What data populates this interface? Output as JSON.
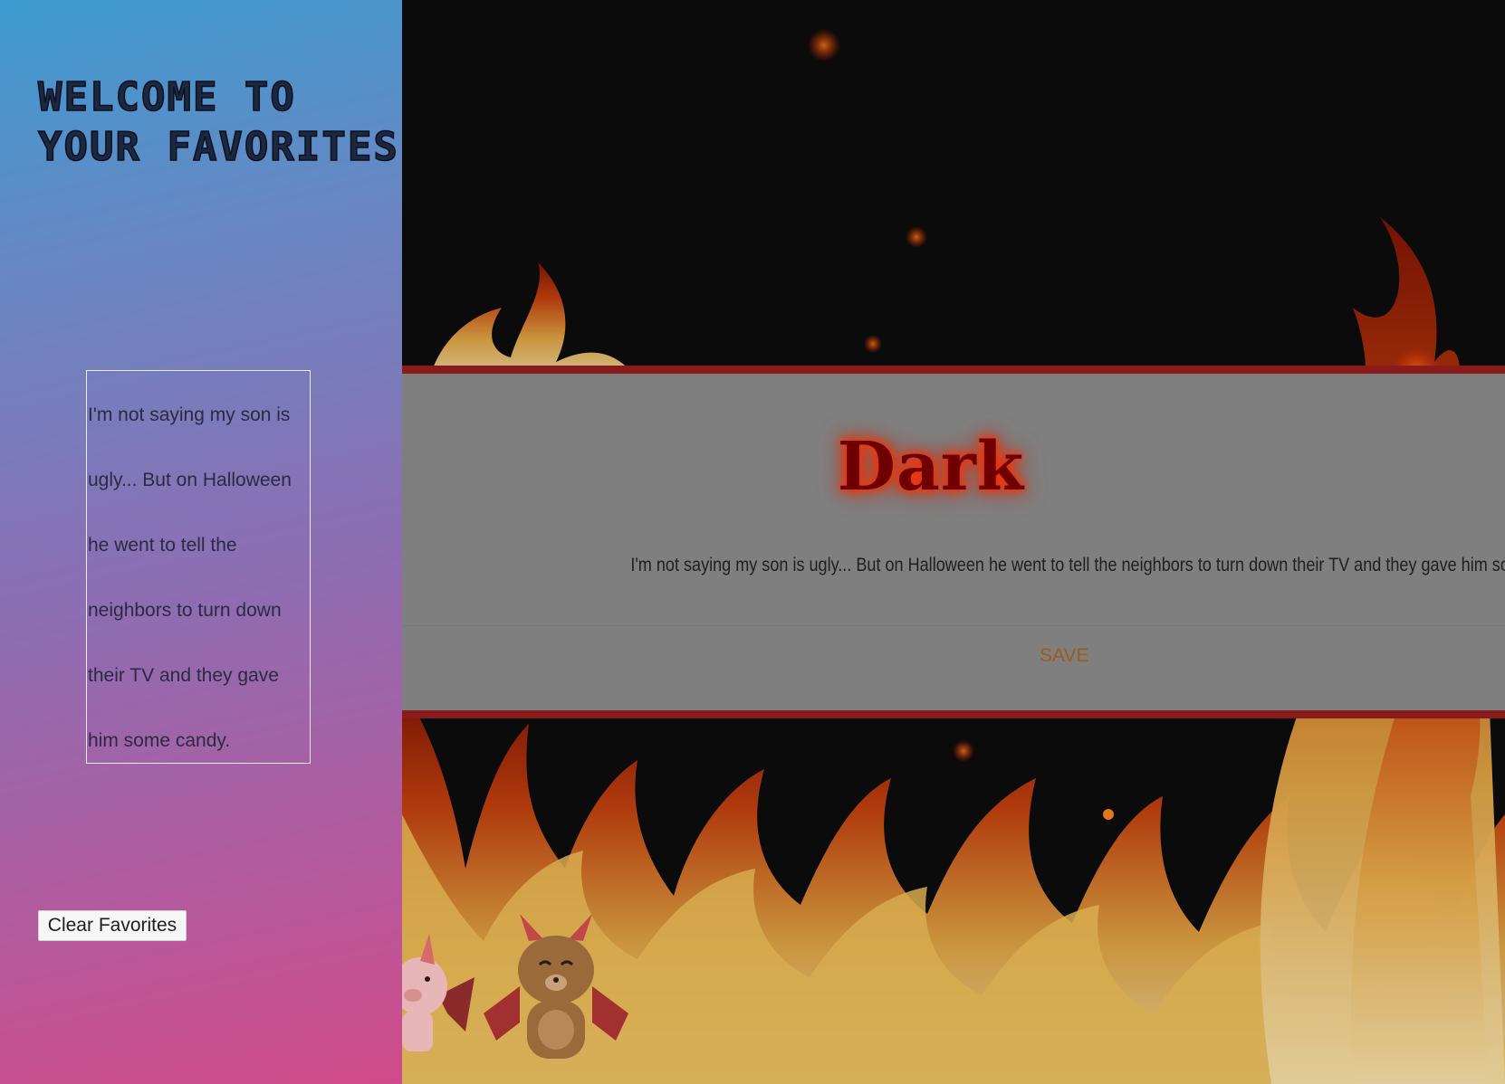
{
  "sidebar": {
    "title": "Welcome to your Favorites",
    "favorites": [
      "I'm not saying my son is ugly... But on Halloween he went to tell the neighbors to turn down their TV and they gave him some candy."
    ],
    "clear_button_label": "Clear Favorites"
  },
  "joke_card": {
    "category": "Dark",
    "joke_text": "I'm not saying my son is ugly... But on Halloween he went to tell the neighbors to turn down their TV and they gave him some candy.",
    "save_label": "SAVE"
  },
  "colors": {
    "sidebar_gradient_top": "#3d9bd1",
    "sidebar_gradient_bottom": "#d14a8a",
    "card_border": "#891b1b",
    "card_background": "#7f7f7f",
    "title_glow": "#ff2a00",
    "save_text": "#9c5a1f"
  },
  "icons": [
    "flame-background",
    "devil-pig-icon",
    "devil-bear-icon"
  ]
}
